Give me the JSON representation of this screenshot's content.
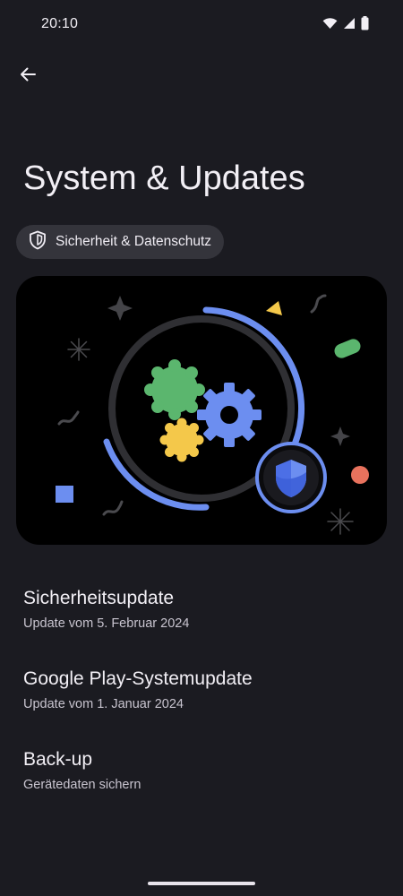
{
  "status_bar": {
    "time": "20:10",
    "icons": [
      "wifi-icon",
      "cellular-signal-icon",
      "battery-icon"
    ]
  },
  "header": {
    "back_icon": "arrow-back-icon",
    "title": "System & Updates"
  },
  "chip": {
    "icon": "shield-icon",
    "label": "Sicherheit & Datenschutz"
  },
  "illustration": {
    "icons": [
      "gear-icon",
      "shield-icon"
    ],
    "colors": {
      "blue": "#6c8ef0",
      "green": "#5bb66e",
      "yellow": "#f4c84a",
      "red": "#e8725d",
      "dark_ring": "#2f2f33"
    }
  },
  "items": [
    {
      "title": "Sicherheitsupdate",
      "subtitle": "Update vom 5. Februar 2024"
    },
    {
      "title": "Google Play-Systemupdate",
      "subtitle": "Update vom 1. Januar 2024"
    },
    {
      "title": "Back-up",
      "subtitle": "Gerätedaten sichern"
    }
  ],
  "colors": {
    "background": "#1b1b21",
    "chip_background": "#34343b",
    "text_primary": "#f2eff5",
    "text_secondary": "#c8c4cf"
  }
}
